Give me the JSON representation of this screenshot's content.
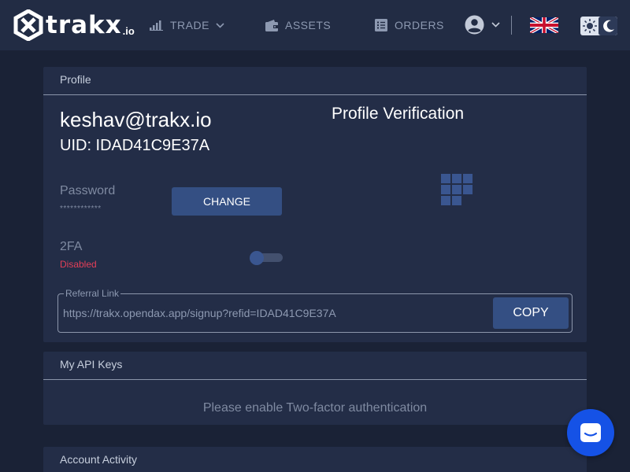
{
  "header": {
    "logo_text": "trakx",
    "logo_suffix": ".io",
    "nav": {
      "trade": "TRADE",
      "assets": "ASSETS",
      "orders": "ORDERS"
    }
  },
  "profile": {
    "card_title": "Profile",
    "email": "keshav@trakx.io",
    "uid": "UID: IDAD41C9E37A",
    "verification_title": "Profile Verification",
    "password_label": "Password",
    "password_mask": "************",
    "change_button": "CHANGE",
    "twofa_label": "2FA",
    "twofa_status": "Disabled",
    "twofa_enabled": false,
    "referral_label": "Referral Link",
    "referral_value": "https://trakx.opendax.app/signup?refid=IDAD41C9E37A",
    "copy_button": "COPY"
  },
  "api_keys": {
    "card_title": "My API Keys",
    "message": "Please enable Two-factor authentication"
  },
  "activity": {
    "card_title": "Account Activity"
  },
  "colors": {
    "background": "#1a2236",
    "header": "#222c44",
    "card": "#232d47",
    "button": "#344f83",
    "danger": "#e43f58",
    "chat": "#1552e6"
  },
  "icons": {
    "trade": "bar-chart-icon",
    "assets": "wallet-icon",
    "orders": "list-icon",
    "user": "user-circle-icon",
    "language": "uk-flag-icon",
    "theme_light": "sun-icon",
    "theme_dark": "moon-icon",
    "verification": "qr-code-icon",
    "chat": "chat-icon"
  }
}
